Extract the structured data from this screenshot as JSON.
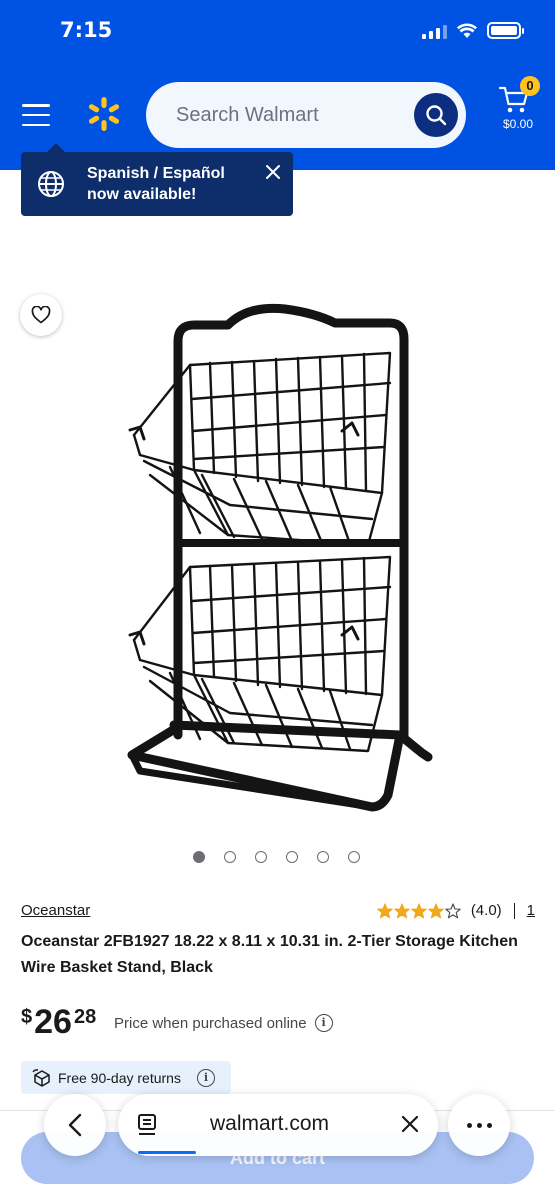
{
  "status_bar": {
    "time": "7:15"
  },
  "header": {
    "search_placeholder": "Search Walmart",
    "cart_count": "0",
    "cart_total": "$0.00"
  },
  "language_tip": {
    "text": "Spanish / Español now available!"
  },
  "gallery": {
    "image_count": 6,
    "active_index": 0
  },
  "product": {
    "brand": "Oceanstar",
    "rating_value": 4.0,
    "rating_text": "(4.0)",
    "review_count": "1",
    "title": "Oceanstar 2FB1927 18.22 x 8.11 x 10.31 in. 2-Tier Storage Kitchen Wire Basket Stand, Black",
    "price_currency": "$",
    "price_dollars": "26",
    "price_cents": "28",
    "price_note": "Price when purchased online",
    "returns": "Free 90-day returns",
    "add_to_cart": "Add to cart"
  },
  "browser": {
    "url": "walmart.com"
  },
  "colors": {
    "header": "#0053e2",
    "spark": "#ffc220",
    "star": "#f0a91c"
  }
}
